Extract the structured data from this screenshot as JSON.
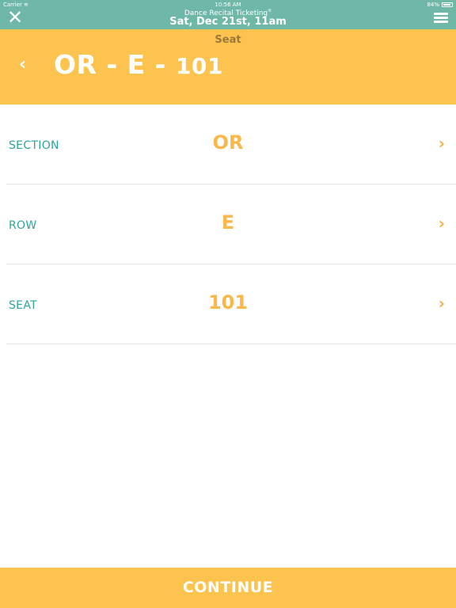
{
  "status": {
    "carrier": "Carrier",
    "time": "10:56 AM",
    "battery": "84%"
  },
  "app": {
    "title": "Dance Recital Ticketing",
    "trademark": "®",
    "event_date": "Sat, Dec 21st, 11am"
  },
  "header": {
    "subtitle": "Seat",
    "seat_main": "OR - E -",
    "seat_number": "101"
  },
  "rows": [
    {
      "label": "SECTION",
      "value": "OR"
    },
    {
      "label": "ROW",
      "value": "E"
    },
    {
      "label": "SEAT",
      "value": "101"
    }
  ],
  "footer": {
    "continue_label": "CONTINUE"
  },
  "icons": {
    "close": "close-icon",
    "menu": "hamburger-menu-icon",
    "back": "chevron-left-icon",
    "chevron": "chevron-right-icon"
  },
  "colors": {
    "topbar": "#6fb8a8",
    "accent": "#fcc34e",
    "label": "#2ea59a",
    "value": "#fbb84a"
  }
}
